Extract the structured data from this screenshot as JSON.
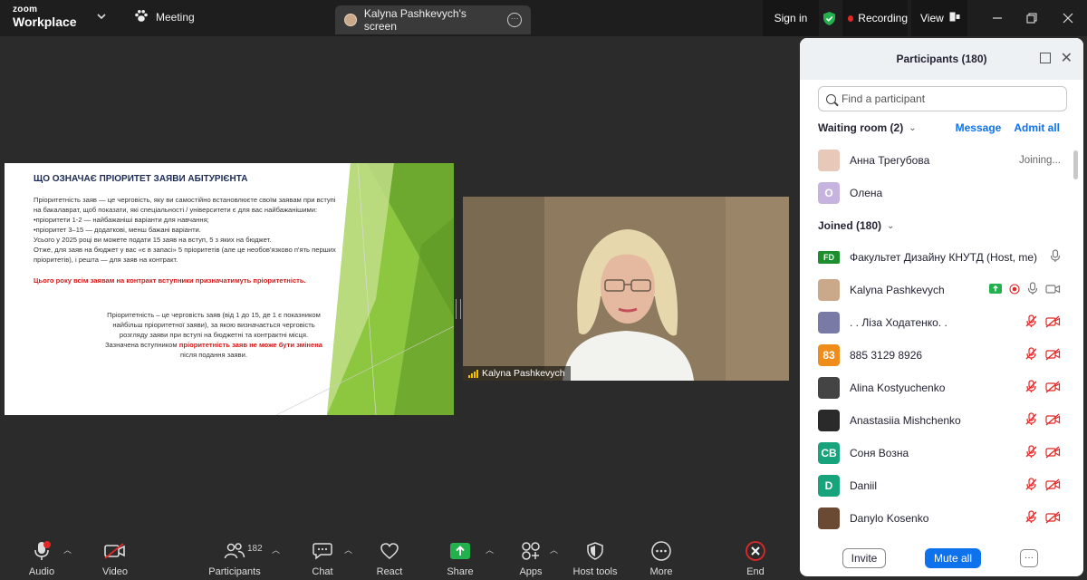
{
  "titlebar": {
    "logo_top": "zoom",
    "logo_bottom": "Workplace",
    "meeting_label": "Meeting",
    "screen_tab_label": "Kalyna Pashkevych's screen",
    "signin_label": "Sign in",
    "recording_label": "Recording",
    "view_label": "View",
    "recording_color": "#e02828",
    "shield_color": "#23b14d"
  },
  "slide": {
    "title": "ЩО ОЗНАЧАЄ ПРІОРИТЕТ ЗАЯВИ АБІТУРІЄНТА",
    "paragraph1": "Пріоритетність заяв — це черговість, яку ви самостійно встановлюєте своїм заявам при вступі на бакалаврат, щоб показати, які спеціальності / університети є для вас найбажанішими:\n•пріоритети 1-2 — найбажаніші варіанти для навчання;\n•пріоритет 3–15 — додаткові, менш бажані варіанти.\nУсього у 2025 році ви можете подати 15 заяв на вступ, 5 з яких на бюджет.\nОтже, для заяв на бюджет у вас «є в запасі» 5 пріоритетів (але це необов'язково п'ять перших пріоритетів), і решта — для заяв на контракт.",
    "red_statement": "Цього року всім заявам на контракт вступники призначатимуть пріоритетність.",
    "p2_part1": "Пріоритетність – це черговість заяв (від 1 до 15, де 1 є показником найбільш пріоритетної заяви), за якою визначається черговість розгляду заяви при вступі на бюджетні та контрактні місця. Зазначена вступником ",
    "p2_red": "пріоритетність заяв не може бути змінена",
    "p2_part2": " після подання заяви."
  },
  "camera": {
    "name": "Kalyna Pashkevych"
  },
  "participants_panel": {
    "title": "Participants (180)",
    "search_placeholder": "Find a participant",
    "waiting_room_label": "Waiting room (2)",
    "message_label": "Message",
    "admit_all_label": "Admit all",
    "joined_label": "Joined (180)",
    "waiting": [
      {
        "name": "Анна Трегубова",
        "status": "Joining...",
        "avatar_color": "#e8c8b8",
        "initial": ""
      },
      {
        "name": "Олена",
        "status": "",
        "avatar_color": "#c7b3e0",
        "initial": "О"
      }
    ],
    "joined": [
      {
        "name": "Факультет Дизайну КНУТД (Host, me)",
        "avatar_text": "FD",
        "avatar_color": "#1a8f2c",
        "icons": "mic-only"
      },
      {
        "name": "Kalyna Pashkevych",
        "avatar_text": "",
        "avatar_color": "#c9a98a",
        "icons": "presenter"
      },
      {
        "name": ". . Ліза Ходатенко. .",
        "avatar_text": "",
        "avatar_color": "#7a7aa6",
        "icons": "muted"
      },
      {
        "name": "885 3129 8926",
        "avatar_text": "83",
        "avatar_color": "#f08c1a",
        "icons": "muted"
      },
      {
        "name": "Alina Kostyuchenko",
        "avatar_text": "",
        "avatar_color": "#444444",
        "icons": "muted"
      },
      {
        "name": "Anastasiia Mishchenko",
        "avatar_text": "",
        "avatar_color": "#2a2a2a",
        "icons": "muted"
      },
      {
        "name": "Соня Возна",
        "avatar_text": "СВ",
        "avatar_color": "#17a37b",
        "icons": "muted"
      },
      {
        "name": "Daniil",
        "avatar_text": "D",
        "avatar_color": "#17a37b",
        "icons": "muted"
      },
      {
        "name": "Danylo Kosenko",
        "avatar_text": "",
        "avatar_color": "#6b4a33",
        "icons": "muted"
      }
    ],
    "invite_label": "Invite",
    "mute_all_label": "Mute all",
    "more_label": "···"
  },
  "toolbar": {
    "audio_label": "Audio",
    "video_label": "Video",
    "participants_label": "Participants",
    "participants_count": "182",
    "chat_label": "Chat",
    "react_label": "React",
    "share_label": "Share",
    "apps_label": "Apps",
    "hosttools_label": "Host tools",
    "more_label": "More",
    "end_label": "End",
    "share_color": "#23b14d",
    "end_color": "#e02828"
  }
}
